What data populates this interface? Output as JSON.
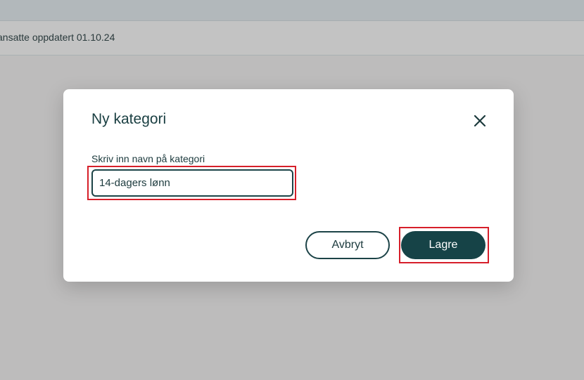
{
  "background": {
    "subheader_text": "ansatte oppdatert 01.10.24"
  },
  "modal": {
    "title": "Ny kategori",
    "close_icon": "close-icon",
    "field_label": "Skriv inn navn på kategori",
    "field_value": "14-dagers lønn",
    "cancel_label": "Avbryt",
    "save_label": "Lagre"
  },
  "colors": {
    "primary": "#164347",
    "highlight": "#d61f2a",
    "overlay": "#bdbcbc"
  }
}
